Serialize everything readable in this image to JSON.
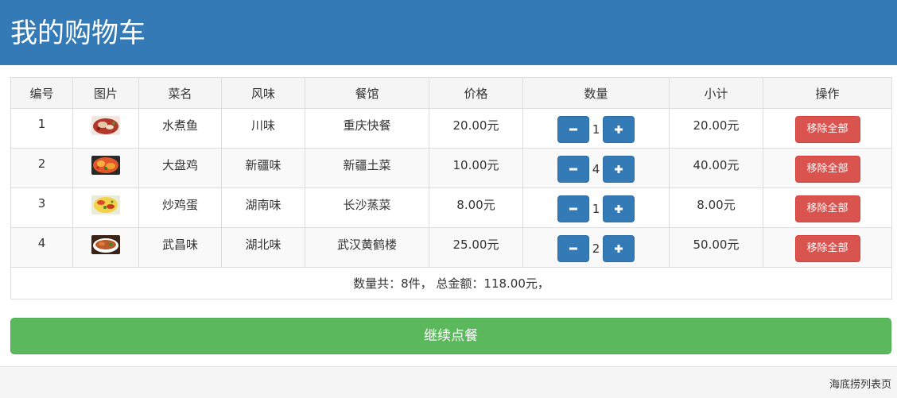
{
  "header": {
    "title": "我的购物车"
  },
  "table": {
    "columns": [
      "编号",
      "图片",
      "菜名",
      "风味",
      "餐馆",
      "价格",
      "数量",
      "小计",
      "操作"
    ],
    "rows": [
      {
        "id": "1",
        "name": "水煮鱼",
        "flavor": "川味",
        "restaurant": "重庆快餐",
        "price": "20.00元",
        "qty": "1",
        "subtotal": "20.00元",
        "action": "移除全部"
      },
      {
        "id": "2",
        "name": "大盘鸡",
        "flavor": "新疆味",
        "restaurant": "新疆土菜",
        "price": "10.00元",
        "qty": "4",
        "subtotal": "40.00元",
        "action": "移除全部"
      },
      {
        "id": "3",
        "name": "炒鸡蛋",
        "flavor": "湖南味",
        "restaurant": "长沙蒸菜",
        "price": "8.00元",
        "qty": "1",
        "subtotal": "8.00元",
        "action": "移除全部"
      },
      {
        "id": "4",
        "name": "武昌味",
        "flavor": "湖北味",
        "restaurant": "武汉黄鹤楼",
        "price": "25.00元",
        "qty": "2",
        "subtotal": "50.00元",
        "action": "移除全部"
      }
    ],
    "summary": "数量共：8件， 总金额：118.00元，"
  },
  "icons": {
    "decrease": "minus-icon",
    "increase": "plus-icon"
  },
  "colors": {
    "primary": "#337ab7",
    "danger": "#d9534f",
    "success": "#5cb85c"
  },
  "continue_button": "继续点餐",
  "footer": {
    "text": "海底捞列表页"
  }
}
